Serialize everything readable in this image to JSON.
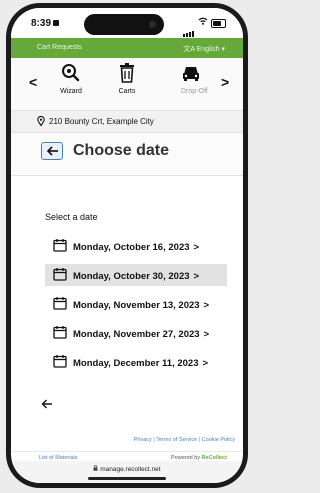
{
  "status": {
    "time": "8:39"
  },
  "appbar": {
    "title": "Cart Requests",
    "language": "文A English ▾"
  },
  "tabs": [
    {
      "label": "Wizard",
      "icon": "wizard-search-icon"
    },
    {
      "label": "Carts",
      "icon": "trash-bin-icon"
    },
    {
      "label": "Drop-Off",
      "icon": "car-icon"
    }
  ],
  "address": "210 Bounty Crt, Example City",
  "page": {
    "title": "Choose date"
  },
  "prompt": "Select a date",
  "dates": [
    {
      "label": "Monday, October 16, 2023",
      "selected": false
    },
    {
      "label": "Monday, October 30, 2023",
      "selected": true
    },
    {
      "label": "Monday, November 13, 2023",
      "selected": false
    },
    {
      "label": "Monday, November 27, 2023",
      "selected": false
    },
    {
      "label": "Monday, December 11, 2023",
      "selected": false
    }
  ],
  "chevron": ">",
  "footer": {
    "privacy": "Privacy",
    "terms": "Terms of Service",
    "cookie": "Cookie Policy",
    "separator": "|",
    "list": "List of Materials",
    "powered": "Powered by",
    "brand": "ReCollect"
  },
  "url": "manage.recollect.net",
  "colors": {
    "brand_green": "#66a93b",
    "link_blue": "#4d80b2"
  }
}
